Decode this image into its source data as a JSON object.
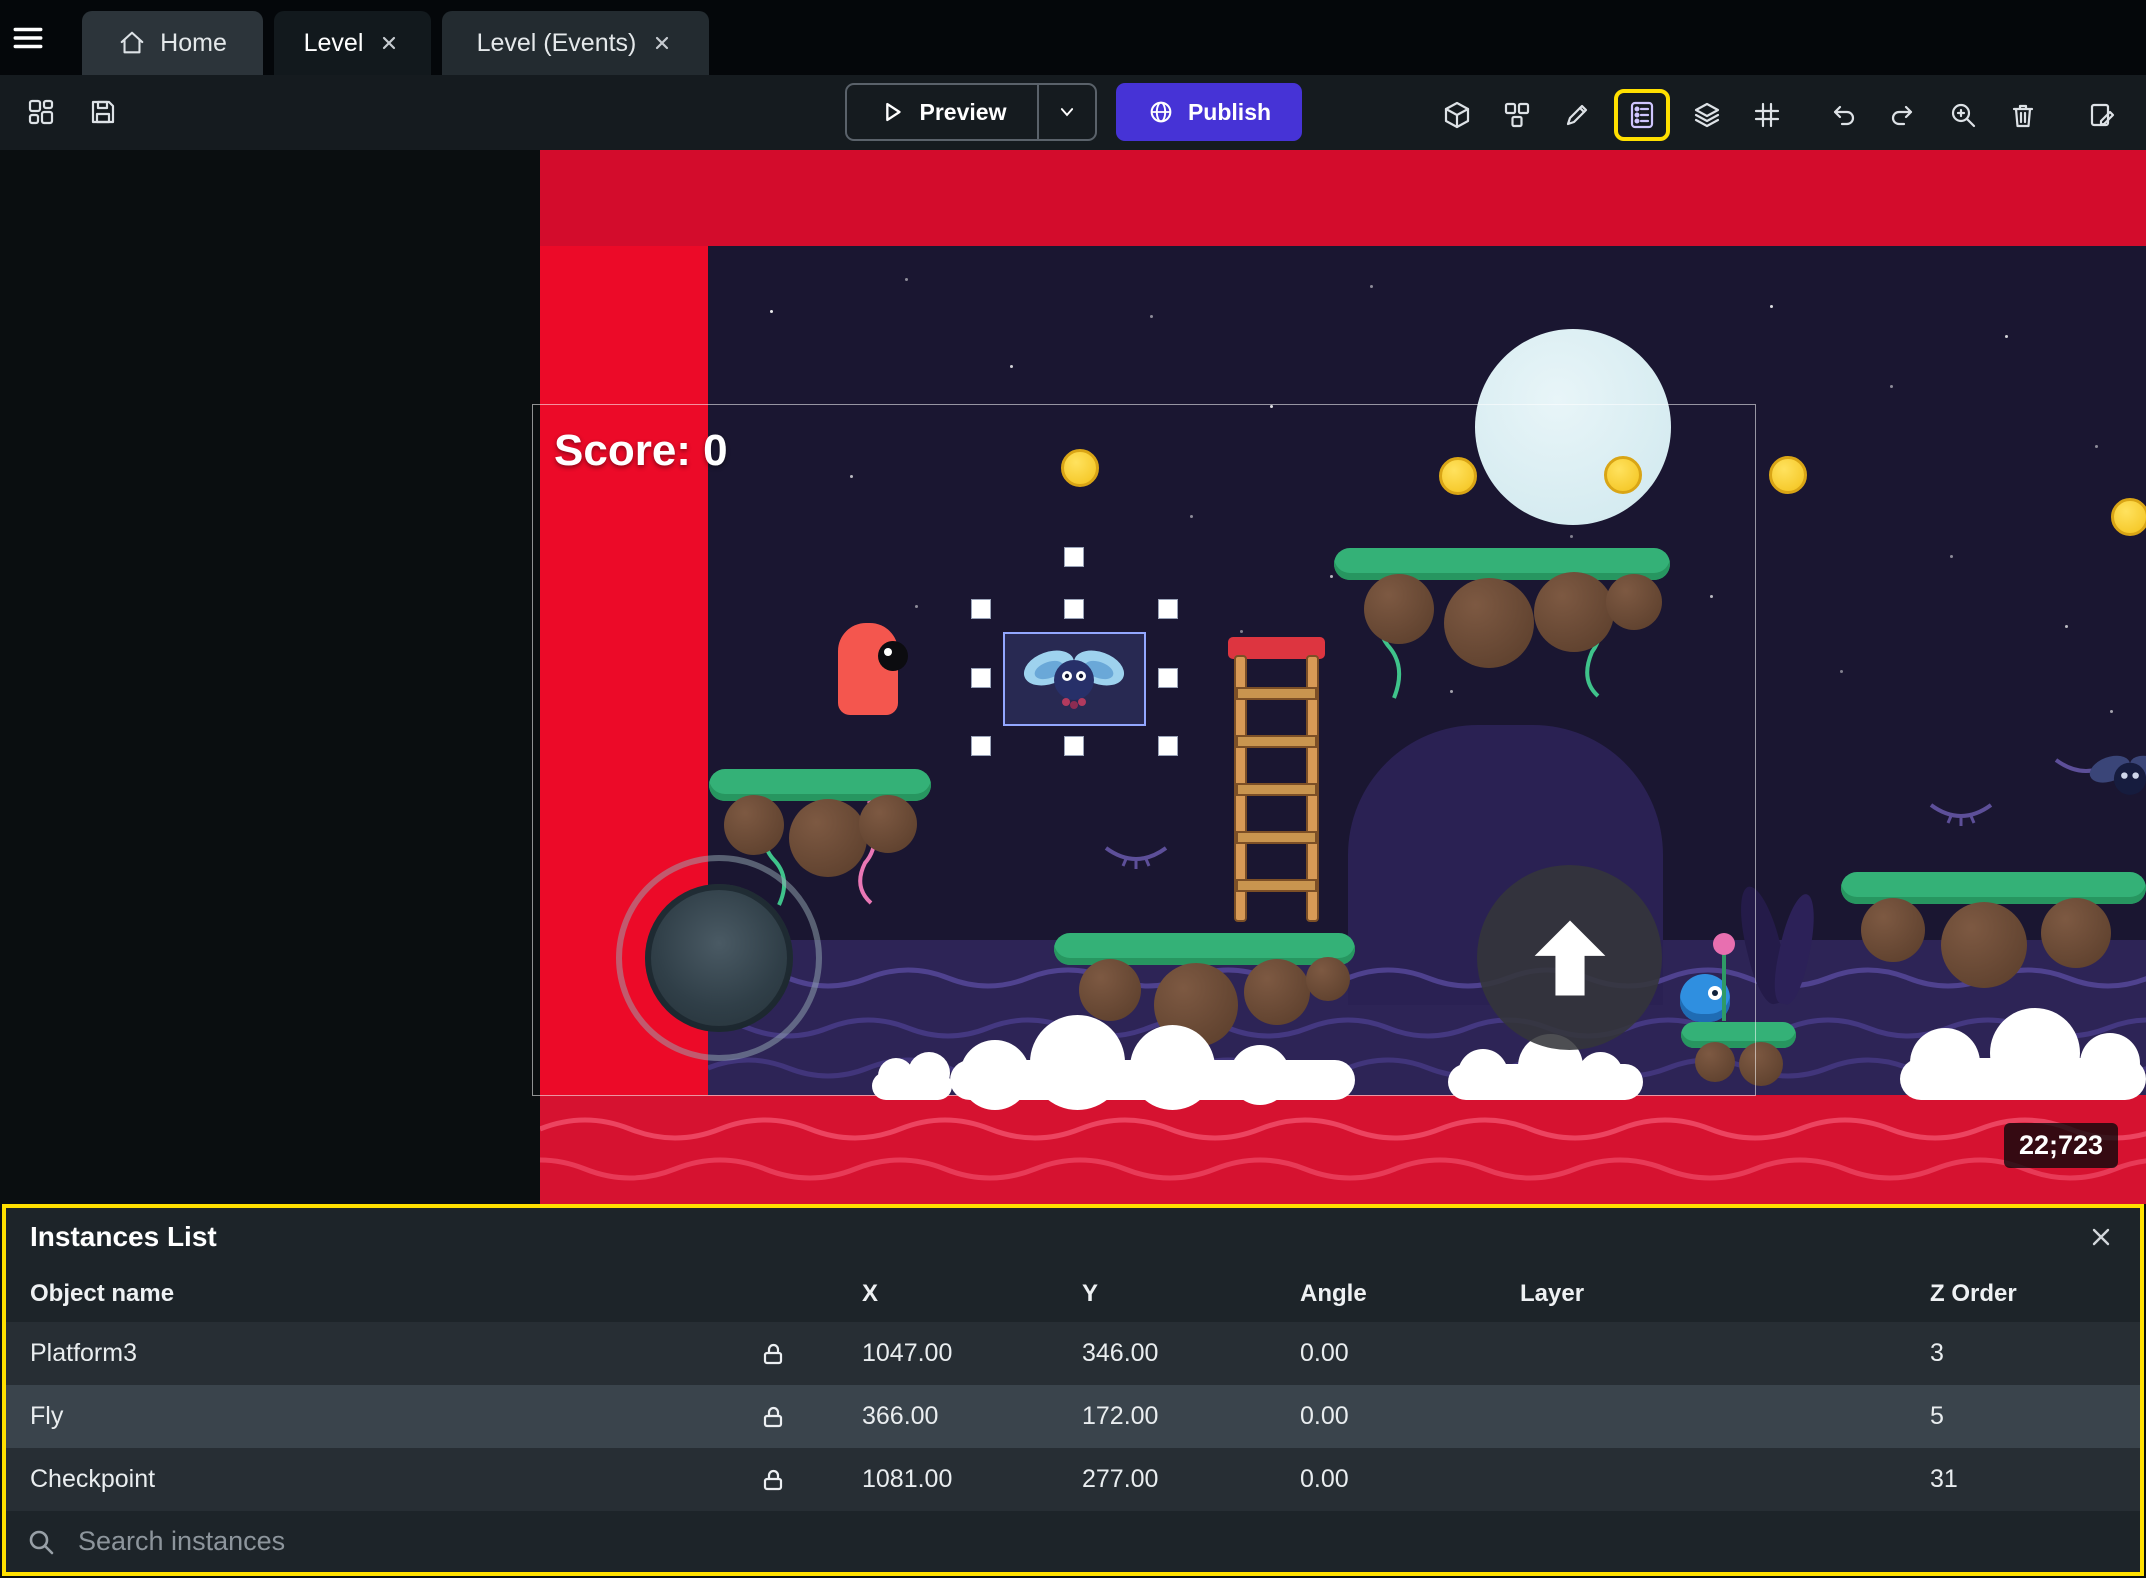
{
  "tabs": {
    "home": "Home",
    "level": "Level",
    "events": "Level (Events)"
  },
  "toolbar": {
    "preview_label": "Preview",
    "publish_label": "Publish"
  },
  "scene": {
    "score_label": "Score: 0",
    "coordinates_badge": "22;723"
  },
  "instances_panel": {
    "title": "Instances List",
    "columns": [
      "Object name",
      "X",
      "Y",
      "Angle",
      "Layer",
      "Z Order"
    ],
    "rows": [
      {
        "name": "Platform3",
        "x": "1047.00",
        "y": "346.00",
        "angle": "0.00",
        "layer": "",
        "z": "3"
      },
      {
        "name": "Fly",
        "x": "366.00",
        "y": "172.00",
        "angle": "0.00",
        "layer": "",
        "z": "5"
      },
      {
        "name": "Checkpoint",
        "x": "1081.00",
        "y": "277.00",
        "angle": "0.00",
        "layer": "",
        "z": "31"
      }
    ],
    "search_placeholder": "Search instances"
  },
  "colors": {
    "highlight": "#ffe000",
    "publish_button": "#4633d6",
    "accent_red": "#e80a26",
    "selection_blue": "#93a7ff"
  }
}
